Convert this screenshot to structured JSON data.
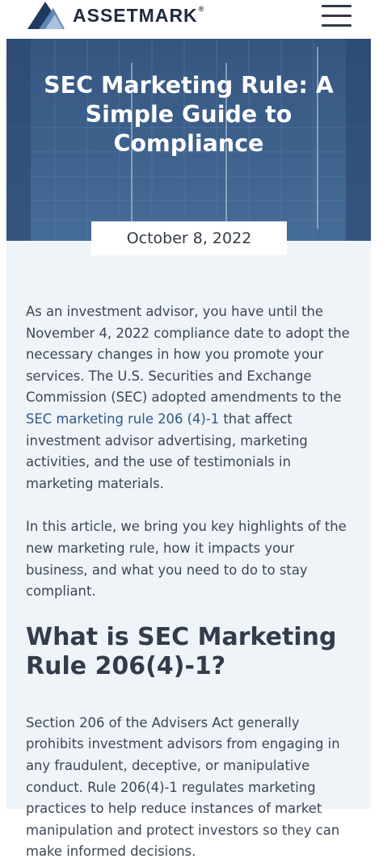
{
  "header": {
    "brand": "ASSETMARK",
    "brand_mark": "®",
    "menu_icon": "hamburger-menu-icon"
  },
  "hero": {
    "title_line1": "SEC Marketing Rule: A",
    "title_line2": "Simple Guide to Compliance",
    "date": "October 8, 2022"
  },
  "article": {
    "p1_before": "As an investment advisor, you have until the November 4, 2022 compliance date to adopt the necessary changes in how you promote your services. The U.S. Securities and Exchange Commission (SEC) adopted amendments to the ",
    "p1_link": "SEC marketing rule 206 (4)-1",
    "p1_after": " that affect investment advisor advertising, marketing activities, and the use of testimonials in marketing materials.",
    "p2": "In this article, we bring you key highlights of the new marketing rule, how it impacts your business, and what you need to do to stay compliant.",
    "heading": "What is SEC Marketing Rule 206(4)-1?",
    "p3": "Section 206 of the Advisers Act generally prohibits investment advisors from engaging in any fraudulent, deceptive, or manipulative conduct. Rule 206(4)-1 regulates marketing practices to help reduce instances of market manipulation and protect investors so they can make informed decisions."
  },
  "colors": {
    "brand_dark": "#1f2b3e",
    "brand_blue": "#2f5f94",
    "page_bg": "#eff4f8",
    "link": "#2e5a86"
  }
}
